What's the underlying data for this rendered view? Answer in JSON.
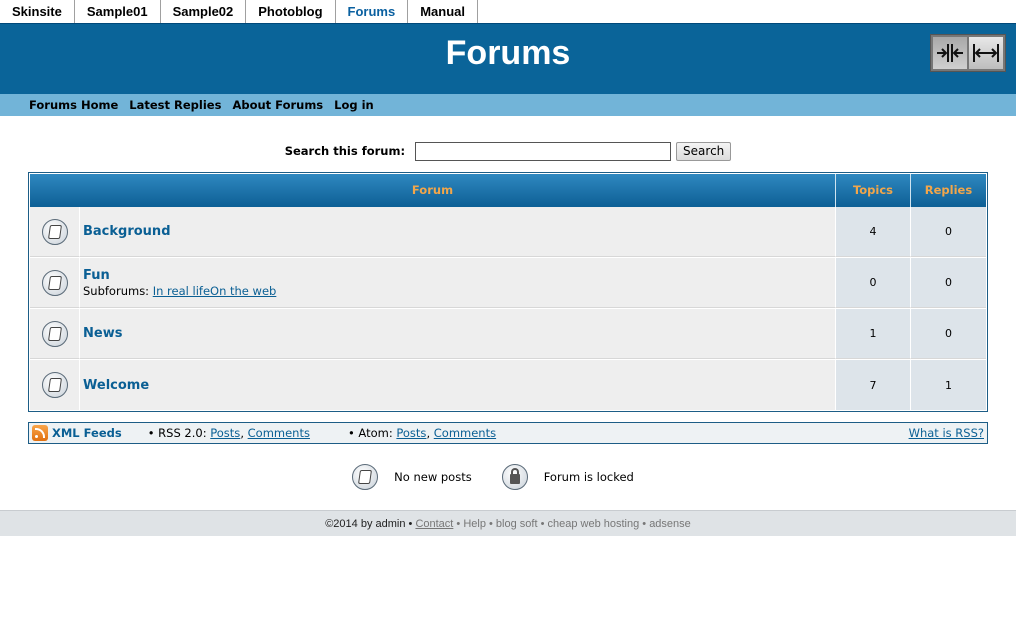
{
  "tabs": [
    {
      "label": "Skinsite"
    },
    {
      "label": "Sample01"
    },
    {
      "label": "Sample02"
    },
    {
      "label": "Photoblog"
    },
    {
      "label": "Forums",
      "active": true
    },
    {
      "label": "Manual"
    }
  ],
  "header": {
    "title": "Forums"
  },
  "width_toggle": {
    "narrow_icon": "collapse-width-icon",
    "wide_icon": "expand-width-icon"
  },
  "subnav": [
    "Forums Home",
    "Latest Replies",
    "About Forums",
    "Log in"
  ],
  "search": {
    "label": "Search this forum:",
    "value": "",
    "button": "Search"
  },
  "table": {
    "headers": {
      "forum": "Forum",
      "topics": "Topics",
      "replies": "Replies"
    },
    "rows": [
      {
        "name": "Background",
        "topics": "4",
        "replies": "0",
        "icon": "forum-no-new-posts-icon"
      },
      {
        "name": "Fun",
        "subforums_label": "Subforums:",
        "subforums": "In real lifeOn the web",
        "topics": "0",
        "replies": "0",
        "icon": "forum-no-new-posts-icon"
      },
      {
        "name": "News",
        "topics": "1",
        "replies": "0",
        "icon": "forum-no-new-posts-icon"
      },
      {
        "name": "Welcome",
        "topics": "7",
        "replies": "1",
        "icon": "forum-no-new-posts-icon"
      }
    ]
  },
  "feeds": {
    "icon": "rss-icon",
    "title": "XML Feeds",
    "rss_label": "RSS 2.0:",
    "atom_label": "Atom:",
    "posts": "Posts",
    "comments": "Comments",
    "what": "What is RSS?"
  },
  "legend": {
    "no_new": "No new posts",
    "locked": "Forum is locked"
  },
  "footer": {
    "copyright": "©2014 by admin",
    "contact": "Contact",
    "help": "Help",
    "blog_soft": "blog soft",
    "hosting": "cheap web hosting",
    "adsense": "adsense"
  },
  "colors": {
    "header_bg": "#0a6499",
    "subnav_bg": "#72b4d8",
    "link": "#0a5f94",
    "th_text": "#f2a64a"
  }
}
